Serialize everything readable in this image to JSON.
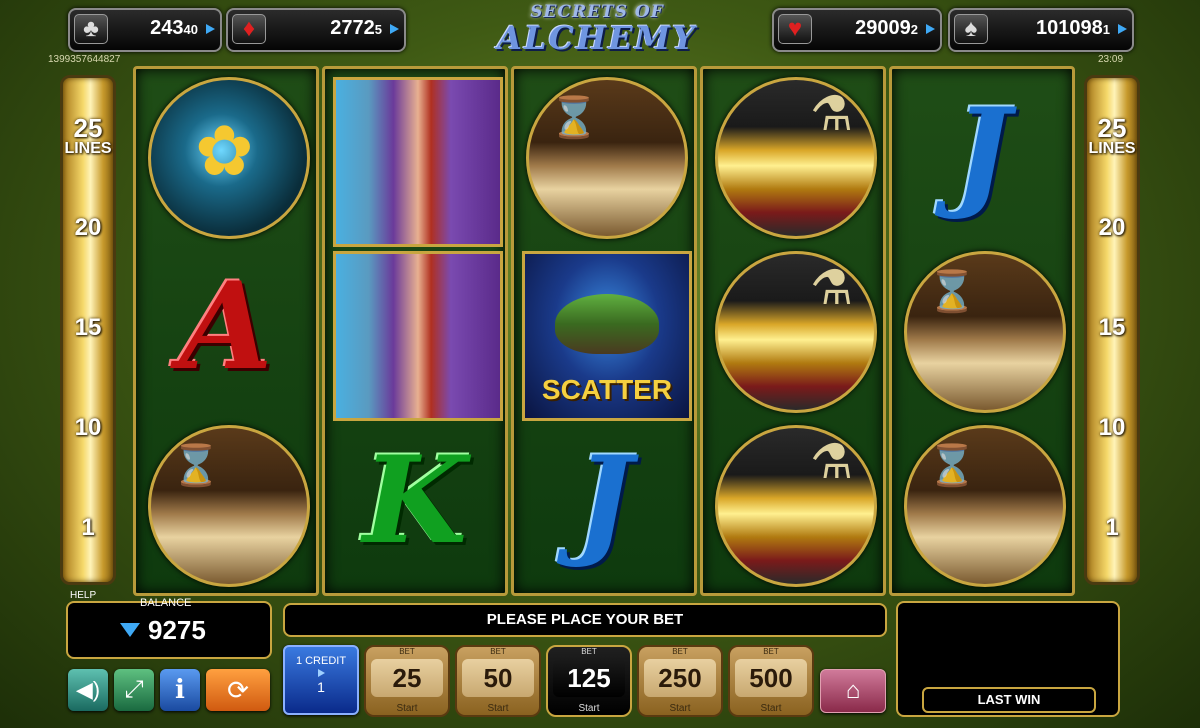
{
  "jackpots": [
    {
      "suit": "♣",
      "value": "243",
      "sub": "40"
    },
    {
      "suit": "♦",
      "value": "2772",
      "sub": "5"
    },
    {
      "suit": "♥",
      "value": "29009",
      "sub": "2"
    },
    {
      "suit": "♠",
      "value": "101098",
      "sub": "1"
    }
  ],
  "session_id": "1399357644827",
  "clock": "23:09",
  "logo": {
    "line1": "SECRETS OF",
    "line2": "ALCHEMY"
  },
  "line_meter": {
    "lines_count": "25",
    "lines_label": "LINES",
    "marks": [
      "20",
      "15",
      "10",
      "1"
    ]
  },
  "reels": [
    [
      "rose",
      "A",
      "book"
    ],
    [
      "woman",
      "woman",
      "K"
    ],
    [
      "book",
      "scatter",
      "J"
    ],
    [
      "gold",
      "gold",
      "gold"
    ],
    [
      "J",
      "book",
      "book"
    ]
  ],
  "scatter_label": "SCATTER",
  "help_label": "HELP",
  "balance": {
    "label": "BALANCE",
    "value": "9275"
  },
  "message": "PLEASE PLACE YOUR BET",
  "last_win_label": "LAST WIN",
  "credit": {
    "label": "1 CREDIT",
    "value": "1"
  },
  "bets": [
    {
      "label": "BET",
      "value": "25",
      "start": "Start",
      "selected": false
    },
    {
      "label": "BET",
      "value": "50",
      "start": "Start",
      "selected": false
    },
    {
      "label": "BET",
      "value": "125",
      "start": "Start",
      "selected": true
    },
    {
      "label": "BET",
      "value": "250",
      "start": "Start",
      "selected": false
    },
    {
      "label": "BET",
      "value": "500",
      "start": "Start",
      "selected": false
    }
  ],
  "controls": {
    "sound_icon": "speaker-icon",
    "fullscreen_icon": "expand-icon",
    "info_icon": "info-icon",
    "autoplay_icon": "autoplay-icon",
    "home_icon": "home-icon",
    "info_glyph": "i"
  }
}
